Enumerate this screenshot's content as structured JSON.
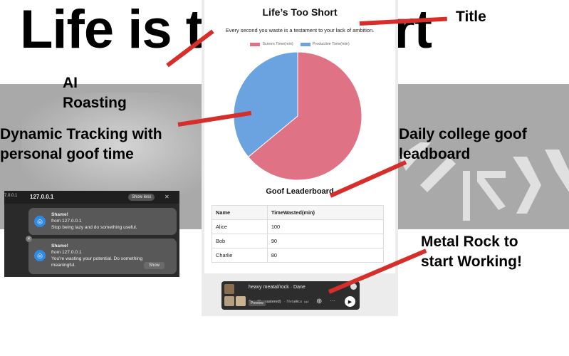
{
  "slide": {
    "big_title": "Life is t",
    "big_title_tail": "rt",
    "annotations": {
      "title": "Title",
      "ai_roasting": [
        "AI",
        "Roasting"
      ],
      "dynamic_tracking": [
        "Dynamic Tracking with",
        "personal goof time"
      ],
      "leaderboard": [
        "Daily college goof",
        "leadboard"
      ],
      "metal_rock": [
        "Metal Rock to",
        "start Working!"
      ]
    },
    "accent_color": "#d62f2b"
  },
  "site": {
    "title": "Life’s Too Short",
    "roast_text": "Every second you waste is a testament to your lack of ambition.",
    "leaderboard_title": "Goof Leaderboard",
    "table_headers": [
      "Name",
      "TimeWasted(min)"
    ],
    "table_rows": [
      [
        "Alice",
        "100"
      ],
      [
        "Bob",
        "90"
      ],
      [
        "Charlie",
        "80"
      ]
    ]
  },
  "chart_data": {
    "type": "pie",
    "series": [
      {
        "name": "Screen Time(min)",
        "value": 64,
        "color": "#e07285"
      },
      {
        "name": "Productive Time(min)",
        "value": 36,
        "color": "#6ba2e0"
      }
    ],
    "legend_position": "top"
  },
  "player": {
    "playlist": "heavy meatal/rock · Dane",
    "track": "One (Remastered)",
    "artist": "Metallica",
    "badge": "Preview"
  },
  "notifications": {
    "host_bar": "127.0.0.1",
    "host_bar_left": "7.0.0.1",
    "show_less": "Show less",
    "cards": [
      {
        "title": "Shame!",
        "from": "from 127.0.0.1",
        "body": "Stop being lazy and do something useful."
      },
      {
        "title": "Shame!",
        "from": "from 127.0.0.1",
        "body": "You're wasting your potential. Do something meaningful.",
        "action": "Show"
      }
    ]
  }
}
